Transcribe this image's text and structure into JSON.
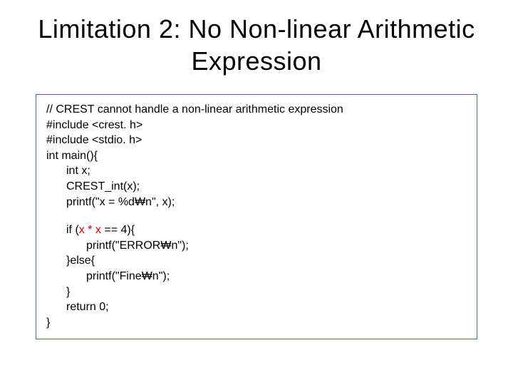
{
  "title": "Limitation 2: No Non-linear Arithmetic Expression",
  "code": {
    "l0": "// CREST cannot handle a non-linear arithmetic expression",
    "l1": "#include <crest. h>",
    "l2": "#include <stdio. h>",
    "l3": "int main(){",
    "l4": "int x;",
    "l5": "CREST_int(x);",
    "l6": "printf(\"x = %d₩n\", x);",
    "l7a": "if (",
    "l7b": "x * x",
    "l7c": " == 4){",
    "l8": "printf(\"ERROR₩n\");",
    "l9": "}else{",
    "l10": "printf(\"Fine₩n\");",
    "l11": "}",
    "l12": "return 0;",
    "l13": "}"
  }
}
